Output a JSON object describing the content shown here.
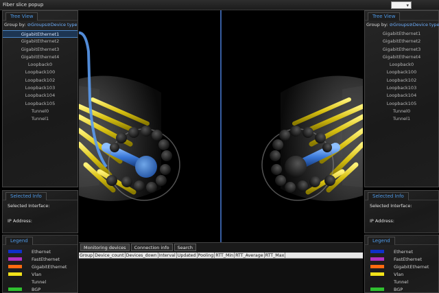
{
  "window": {
    "title": "Fiber slice popup"
  },
  "left": {
    "tree_tab": "Tree View",
    "group_by_label": "Group by:",
    "group_options": [
      "Groups",
      "Device type"
    ],
    "items": [
      "GigabitEthernet1",
      "GigabitEthernet2",
      "GigabitEthernet3",
      "GigabitEthernet4",
      "Loopback0",
      "Loopback100",
      "Loopback102",
      "Loopback103",
      "Loopback104",
      "Loopback105",
      "Tunnel0",
      "Tunnel1"
    ],
    "selected_index": 0,
    "info_tab": "Selected Info",
    "selected_interface_label": "Selected Interface:",
    "ip_address_label": "IP Address:",
    "legend_tab": "Legend"
  },
  "right": {
    "tree_tab": "Tree View",
    "group_by_label": "Group by:",
    "group_options": [
      "Groups",
      "Device type"
    ],
    "items": [
      "GigabitEthernet1",
      "GigabitEthernet2",
      "GigabitEthernet3",
      "GigabitEthernet4",
      "Loopback0",
      "Loopback100",
      "Loopback102",
      "Loopback103",
      "Loopback104",
      "Loopback105",
      "Tunnel0",
      "Tunnel1"
    ],
    "info_tab": "Selected Info",
    "selected_interface_label": "Selected Interface:",
    "ip_address_label": "IP Address:",
    "legend_tab": "Legend"
  },
  "legend": [
    {
      "label": "Ethernet",
      "color": "#1030c8"
    },
    {
      "label": "FastEthernet",
      "color": "#b030c0"
    },
    {
      "label": "GigabitEthernet",
      "color": "#ff6a10"
    },
    {
      "label": "Vlan",
      "color": "#f2e21a"
    },
    {
      "label": "Tunnel",
      "color": ""
    },
    {
      "label": "BGP",
      "color": "#30c030"
    }
  ],
  "bottom": {
    "tabs": [
      "Monitoring devices",
      "Connection info",
      "Search"
    ],
    "columns": [
      "Group",
      "Device_count",
      "Devices_down",
      "Interval",
      "Updated",
      "Pooling",
      "RTT_Min",
      "RTT_Average",
      "RTT_Max"
    ]
  },
  "colors": {
    "accent": "#4f9ae8",
    "fiber_blue": "#3a78d8",
    "fiber_yellow": "#e8d21a"
  }
}
